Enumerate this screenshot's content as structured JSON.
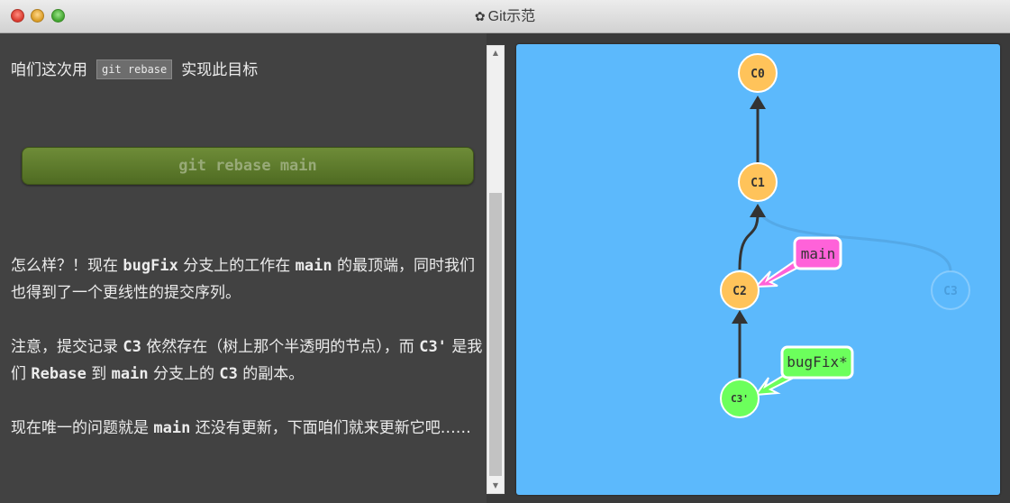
{
  "window": {
    "title": "Git示范",
    "title_icon": "gear-icon"
  },
  "instructions": {
    "intro_before": "咱们这次用",
    "intro_code": "git rebase",
    "intro_after": "实现此目标",
    "command_button": "git rebase main",
    "p1_a": "怎么样？！现在 ",
    "p1_b": "bugFix",
    "p1_c": " 分支上的工作在 ",
    "p1_d": "main",
    "p1_e": " 的最顶端，同时我们也得到了一个更线性的提交序列。",
    "p2_a": "注意，提交记录 ",
    "p2_b": "C3",
    "p2_c": " 依然存在（树上那个半透明的节点），而 ",
    "p2_d": "C3'",
    "p2_e": " 是我们 ",
    "p2_f": "Rebase",
    "p2_g": " 到 ",
    "p2_h": "main",
    "p2_i": " 分支上的 ",
    "p2_j": "C3",
    "p2_k": " 的副本。",
    "p3_a": "现在唯一的问题就是 ",
    "p3_b": "main",
    "p3_c": " 还没有更新，下面咱们就来更新它吧……"
  },
  "graph": {
    "commits": [
      {
        "id": "C0",
        "color": "#ffc35a"
      },
      {
        "id": "C1",
        "color": "#ffc35a"
      },
      {
        "id": "C2",
        "color": "#ffc35a"
      },
      {
        "id": "C3",
        "color": "#5cb9fc",
        "ghost": true
      },
      {
        "id": "C3'",
        "color": "#6cff5c"
      }
    ],
    "branches": [
      {
        "name": "main",
        "color": "#ff62d9",
        "target": "C2"
      },
      {
        "name": "bugFix*",
        "color": "#6cff5c",
        "target": "C3'"
      }
    ]
  }
}
